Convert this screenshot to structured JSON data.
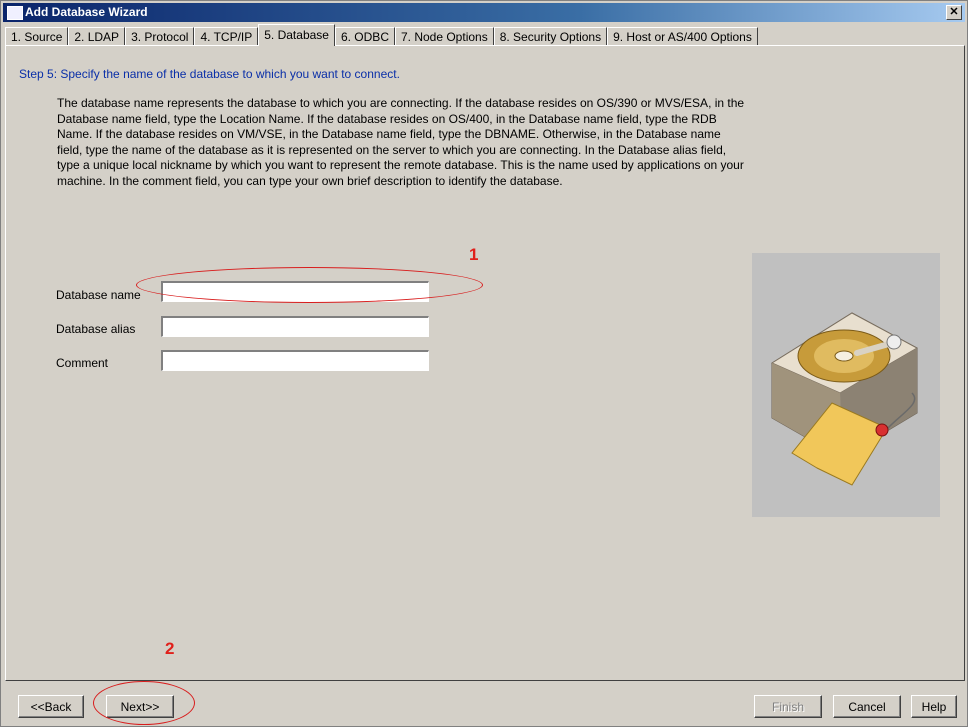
{
  "window": {
    "title": "Add Database Wizard",
    "close_glyph": "✕"
  },
  "tabs": [
    {
      "label": "1. Source"
    },
    {
      "label": "2. LDAP"
    },
    {
      "label": "3. Protocol"
    },
    {
      "label": "4. TCP/IP"
    },
    {
      "label": "5. Database"
    },
    {
      "label": "6. ODBC"
    },
    {
      "label": "7. Node Options"
    },
    {
      "label": "8. Security Options"
    },
    {
      "label": "9. Host or AS/400 Options"
    }
  ],
  "active_tab": "5. Database",
  "step": "Step 5: Specify the name of the database to which you want to connect.",
  "description": "The database name represents the database to which you are connecting.   If the database resides on OS/390 or MVS/ESA, in the Database name field, type the Location Name.   If the database resides on OS/400, in the Database name field, type the RDB Name.   If the database resides on VM/VSE, in the Database name field, type the DBNAME.   Otherwise, in the Database name field, type the name of the database as it is represented on the server to which you are connecting.   In the Database alias field, type a unique local nickname by which you want to represent the remote database.   This is the name used by applications on your machine.   In the comment field, you can type your own brief description to identify the database.",
  "fields": {
    "database_name": {
      "label": "Database name",
      "value": ""
    },
    "database_alias": {
      "label": "Database alias",
      "value": ""
    },
    "comment": {
      "label": "Comment",
      "value": ""
    }
  },
  "buttons": {
    "back": "<<Back",
    "next": "Next>>",
    "finish": "Finish",
    "cancel": "Cancel",
    "help": "Help"
  },
  "annotations": {
    "one": "1",
    "two": "2"
  },
  "colors": {
    "title_bar": "#0a246a",
    "step_text": "#0a2fa8",
    "annotation": "#e0201b",
    "background": "#d4d0c8"
  },
  "icons": {
    "illustration": "hard-drive-with-tag-icon"
  }
}
